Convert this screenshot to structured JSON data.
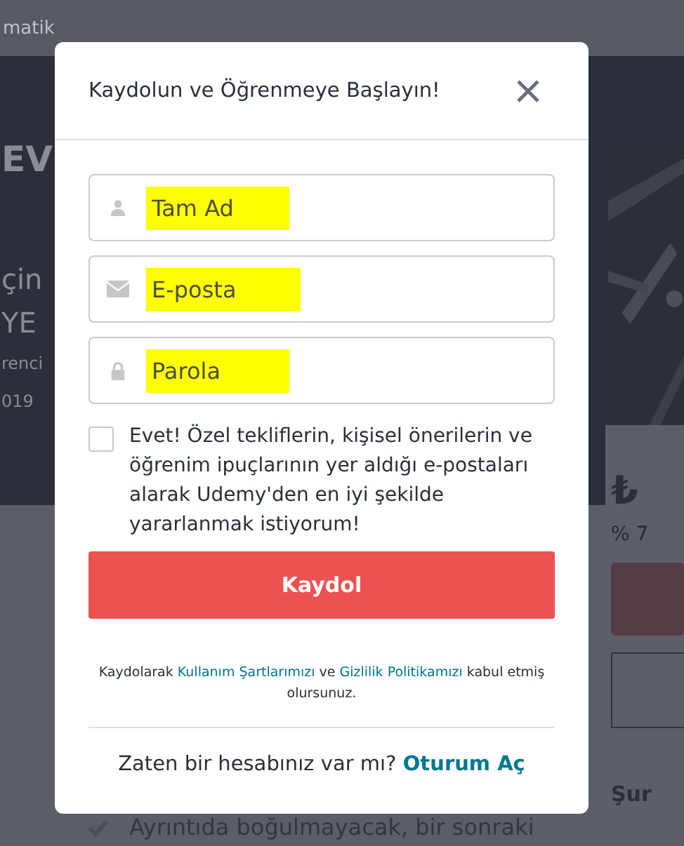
{
  "background": {
    "nav_text": "matik",
    "hero_title": "EV",
    "hero_lines": [
      "çin",
      "YE"
    ],
    "hero_meta": [
      "renci",
      "019"
    ],
    "price": "₺",
    "discount": "% 7",
    "sidebar_heading": "Şur",
    "feature": "Ayrıntıda boğulmayacak, bir sonraki"
  },
  "modal": {
    "title": "Kaydolun ve Öğrenmeye Başlayın!",
    "fields": [
      {
        "kind": "name",
        "placeholder": "Tam Ad",
        "highlighted": true
      },
      {
        "kind": "email",
        "placeholder": "E-posta",
        "highlighted": true
      },
      {
        "kind": "password",
        "placeholder": "Parola",
        "highlighted": true
      }
    ],
    "consent": {
      "label": "Evet! Özel tekliflerin, kişisel önerilerin ve öğrenim ipuçlarının yer aldığı e-postaları alarak Udemy'den en iyi şekilde yararlanmak istiyorum!",
      "checked": false
    },
    "submit": "Kaydol",
    "terms": {
      "before": "Kaydolarak",
      "link1": "Kullanım Şartlarımızı",
      "middle": "ve",
      "link2": "Gizlilik Politikamızı",
      "after": "kabul etmiş olursunuz."
    },
    "login": {
      "prompt": "Zaten bir hesabınız var mı?",
      "link": "Oturum Aç"
    }
  }
}
